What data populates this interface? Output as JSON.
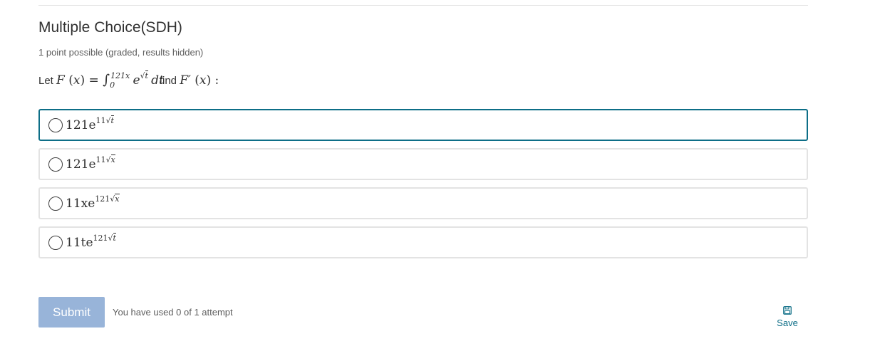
{
  "problem": {
    "title": "Multiple Choice(SDH)",
    "meta": "1 point possible (graded, results hidden)",
    "prompt_let": "Let",
    "prompt_find": "find"
  },
  "choices": [
    {
      "coef": "121e",
      "exp_prefix": "11",
      "radicand": "t",
      "selected": false
    },
    {
      "coef": "121e",
      "exp_prefix": "11",
      "radicand": "x",
      "selected": false
    },
    {
      "coef": "11xe",
      "exp_prefix": "121",
      "radicand": "x",
      "selected": false
    },
    {
      "coef": "11te",
      "exp_prefix": "121",
      "radicand": "t",
      "selected": false
    }
  ],
  "footer": {
    "submit_label": "Submit",
    "attempts_text": "You have used 0 of 1 attempt",
    "save_label": "Save",
    "save_icon": "floppy-disk-icon"
  },
  "colors": {
    "accent": "#0d6e87",
    "submit_bg": "#98b4d9",
    "border": "#e3e3e3"
  }
}
